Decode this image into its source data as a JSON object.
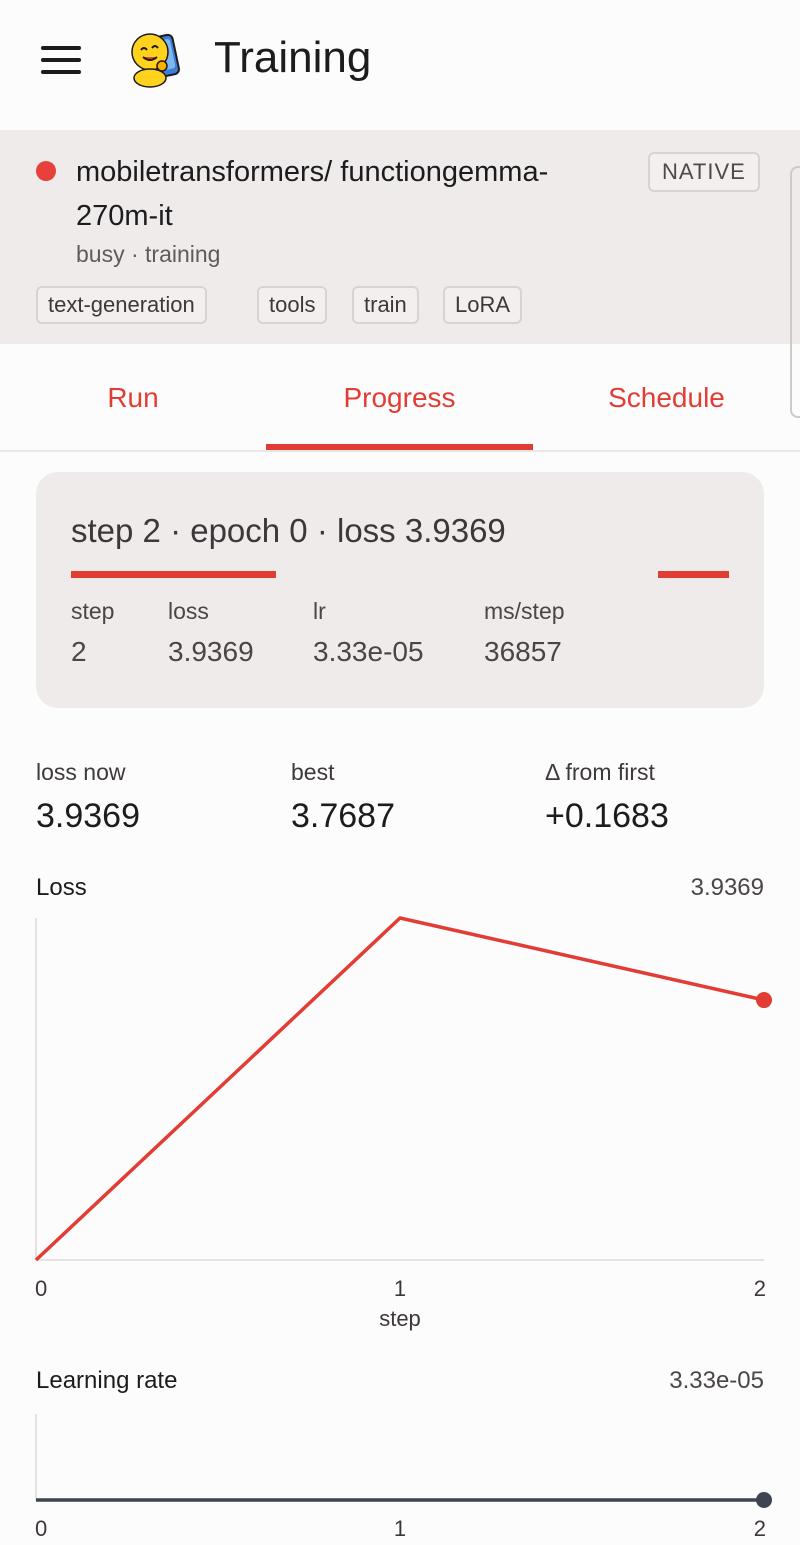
{
  "app": {
    "title": "Training",
    "menu_icon": "hamburger-menu-icon",
    "logo_icon": "hugging-face-mascot-icon"
  },
  "model": {
    "name": "mobiletransformers/ functiongemma-270m-it",
    "status": "busy · training",
    "status_color": "#e8403a",
    "badge": "NATIVE",
    "tags": [
      "text-generation",
      "tools",
      "train",
      "LoRA"
    ]
  },
  "tabs": [
    {
      "label": "Run",
      "active": false
    },
    {
      "label": "Progress",
      "active": true
    },
    {
      "label": "Schedule",
      "active": false
    }
  ],
  "progress": {
    "headline": "step 2 · epoch 0 · loss 3.9369",
    "stats": [
      {
        "label": "step",
        "value": "2"
      },
      {
        "label": "loss",
        "value": "3.9369"
      },
      {
        "label": "lr",
        "value": "3.33e-05"
      },
      {
        "label": "ms/step",
        "value": "36857"
      }
    ]
  },
  "summary": [
    {
      "label": "loss now",
      "value": "3.9369"
    },
    {
      "label": "best",
      "value": "3.7687"
    },
    {
      "label": "Δ from first",
      "value": "+0.1683"
    }
  ],
  "colors": {
    "accent": "#e23d35",
    "lr_line": "#3d4552"
  },
  "chart_data": [
    {
      "type": "line",
      "title": "Loss",
      "current_value": "3.9369",
      "xlabel": "step",
      "x": [
        0,
        1,
        2
      ],
      "x_ticks": [
        "0",
        "1",
        "2"
      ],
      "series": [
        {
          "values": [
            3.7687,
            3.99,
            3.9369
          ]
        }
      ],
      "ylim": [
        3.7687,
        3.99
      ],
      "grid": false
    },
    {
      "type": "line",
      "title": "Learning rate",
      "current_value": "3.33e-05",
      "xlabel": "",
      "x": [
        0,
        1,
        2
      ],
      "x_ticks": [
        "0",
        "1",
        "2"
      ],
      "series": [
        {
          "values": [
            3.33e-05,
            3.33e-05,
            3.33e-05
          ]
        }
      ],
      "grid": false
    }
  ]
}
